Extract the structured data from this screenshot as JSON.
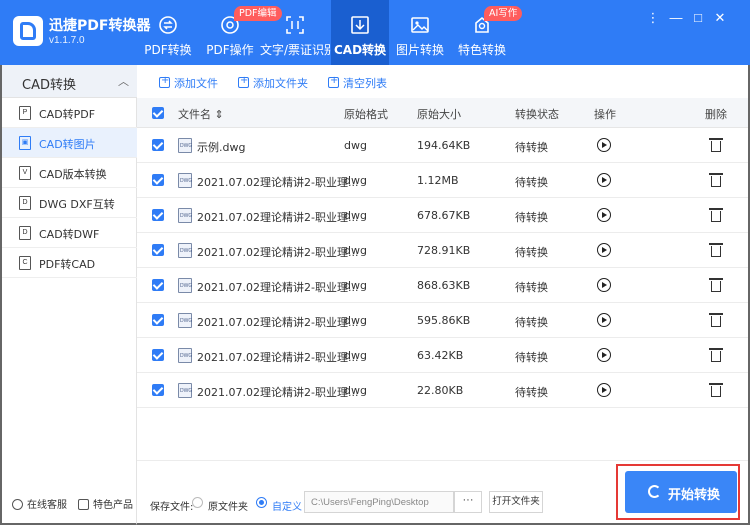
{
  "app": {
    "name": "迅捷PDF转换器",
    "version": "v1.1.7.0"
  },
  "nav": {
    "tabs": [
      {
        "label": "PDF转换",
        "icon": "convert-icon"
      },
      {
        "label": "PDF操作",
        "icon": "settings-cycle-icon",
        "badge": "PDF编辑"
      },
      {
        "label": "文字/票证识别",
        "icon": "ocr-frame-icon"
      },
      {
        "label": "CAD转换",
        "icon": "cad-icon",
        "active": true
      },
      {
        "label": "图片转换",
        "icon": "image-icon"
      },
      {
        "label": "特色转换",
        "icon": "feature-icon",
        "badge": "AI写作"
      }
    ]
  },
  "window": {
    "controls": [
      "⋮",
      "—",
      "□",
      "✕"
    ]
  },
  "sidebar": {
    "header": "CAD转换",
    "items": [
      {
        "label": "CAD转PDF",
        "icon": "pdf-icon"
      },
      {
        "label": "CAD转图片",
        "icon": "image-icon",
        "active": true
      },
      {
        "label": "CAD版本转换",
        "icon": "version-icon"
      },
      {
        "label": "DWG DXF互转",
        "icon": "dwg-icon"
      },
      {
        "label": "CAD转DWF",
        "icon": "dwf-icon"
      },
      {
        "label": "PDF转CAD",
        "icon": "pdf-cad-icon"
      }
    ],
    "footer": {
      "support": "在线客服",
      "features": "特色产品"
    }
  },
  "toolbar": {
    "add_file": "添加文件",
    "add_folder": "添加文件夹",
    "clear_list": "清空列表"
  },
  "table": {
    "headers": {
      "name": "文件名 ⇕",
      "format": "原始格式",
      "size": "原始大小",
      "status": "转换状态",
      "action": "操作",
      "delete": "删除"
    },
    "rows": [
      {
        "name": "示例.dwg",
        "format": "dwg",
        "size": "194.64KB",
        "status": "待转换"
      },
      {
        "name": "2021.07.02理论精讲2-职业理...",
        "format": "dwg",
        "size": "1.12MB",
        "status": "待转换"
      },
      {
        "name": "2021.07.02理论精讲2-职业理...",
        "format": "dwg",
        "size": "678.67KB",
        "status": "待转换"
      },
      {
        "name": "2021.07.02理论精讲2-职业理...",
        "format": "dwg",
        "size": "728.91KB",
        "status": "待转换"
      },
      {
        "name": "2021.07.02理论精讲2-职业理...",
        "format": "dwg",
        "size": "868.63KB",
        "status": "待转换"
      },
      {
        "name": "2021.07.02理论精讲2-职业理...",
        "format": "dwg",
        "size": "595.86KB",
        "status": "待转换"
      },
      {
        "name": "2021.07.02理论精讲2-职业理...",
        "format": "dwg",
        "size": "63.42KB",
        "status": "待转换"
      },
      {
        "name": "2021.07.02理论精讲2-职业理...",
        "format": "dwg",
        "size": "22.80KB",
        "status": "待转换"
      }
    ]
  },
  "footer": {
    "save_label": "保存文件:",
    "original_folder": "原文件夹",
    "custom": "自定义",
    "path": "C:\\Users\\FengPing\\Desktop",
    "browse": "···",
    "open_folder": "打开文件夹",
    "start": "开始转换"
  },
  "colors": {
    "accent": "#2f7cf6",
    "header_bg": "#2f7cf6",
    "highlight_frame": "#e53935"
  }
}
